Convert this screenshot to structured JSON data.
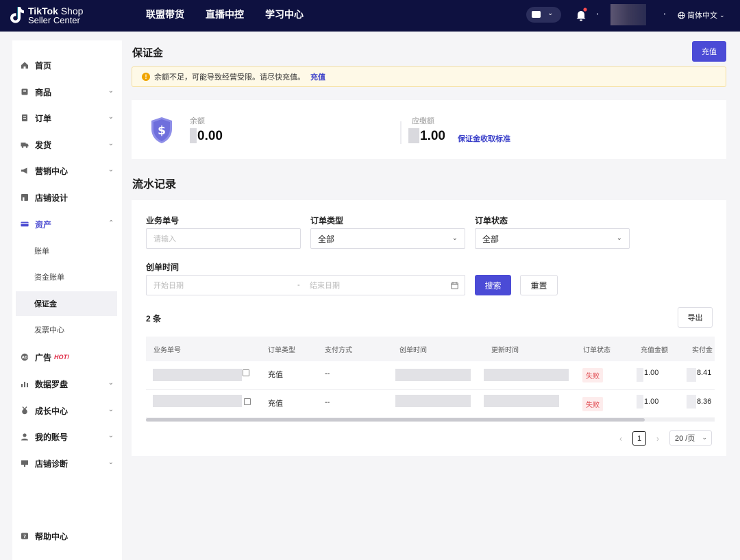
{
  "brand": {
    "name_bold": "TikTok",
    "name_rest": "Shop",
    "subtitle": "Seller Center"
  },
  "topnav": [
    "联盟带货",
    "直播中控",
    "学习中心"
  ],
  "language": "简体中文",
  "sidebar": {
    "items": [
      {
        "label": "首页",
        "icon": "home-icon"
      },
      {
        "label": "商品",
        "icon": "product-icon"
      },
      {
        "label": "订单",
        "icon": "order-icon"
      },
      {
        "label": "发货",
        "icon": "truck-icon"
      },
      {
        "label": "营销中心",
        "icon": "megaphone-icon"
      },
      {
        "label": "店铺设计",
        "icon": "store-icon"
      },
      {
        "label": "资产",
        "icon": "wallet-icon"
      },
      {
        "label": "广告",
        "icon": "ad-icon",
        "badge": "HOT!"
      },
      {
        "label": "数据罗盘",
        "icon": "chart-icon"
      },
      {
        "label": "成长中心",
        "icon": "medal-icon"
      },
      {
        "label": "我的账号",
        "icon": "account-icon"
      },
      {
        "label": "店铺诊断",
        "icon": "diagnose-icon"
      },
      {
        "label": "帮助中心",
        "icon": "help-icon"
      }
    ],
    "sub_items": [
      "账单",
      "资金账单",
      "保证金",
      "发票中心"
    ]
  },
  "page": {
    "title": "保证金",
    "recharge_label": "充值",
    "alert": {
      "text": "余额不足，可能导致经营受限。请尽快充值。",
      "link": "充值"
    },
    "balance": {
      "label": "余额",
      "value": "0.00"
    },
    "payable": {
      "label": "应缴额",
      "value": "1.00",
      "link": "保证金收取标准"
    }
  },
  "records": {
    "title": "流水记录",
    "filters": {
      "order_no": {
        "label": "业务单号",
        "placeholder": "请输入"
      },
      "order_type": {
        "label": "订单类型",
        "value": "全部"
      },
      "order_status": {
        "label": "订单状态",
        "value": "全部"
      },
      "created": {
        "label": "创单时间",
        "start": "开始日期",
        "end": "结束日期",
        "sep": "-"
      }
    },
    "search_label": "搜索",
    "reset_label": "重置",
    "count_text": "2 条",
    "export_label": "导出",
    "columns": [
      "业务单号",
      "订单类型",
      "支付方式",
      "创单时间",
      "更新时间",
      "订单状态",
      "充值金额",
      "实付金"
    ],
    "rows": [
      {
        "type": "充值",
        "pay": "--",
        "status": "失败",
        "amount": "1.00",
        "paid": "8.41"
      },
      {
        "type": "充值",
        "pay": "--",
        "status": "失败",
        "amount": "1.00",
        "paid": "8.36"
      }
    ],
    "pagination": {
      "prev": "‹",
      "next": "›",
      "current": "1",
      "page_size": "20 /页"
    }
  }
}
